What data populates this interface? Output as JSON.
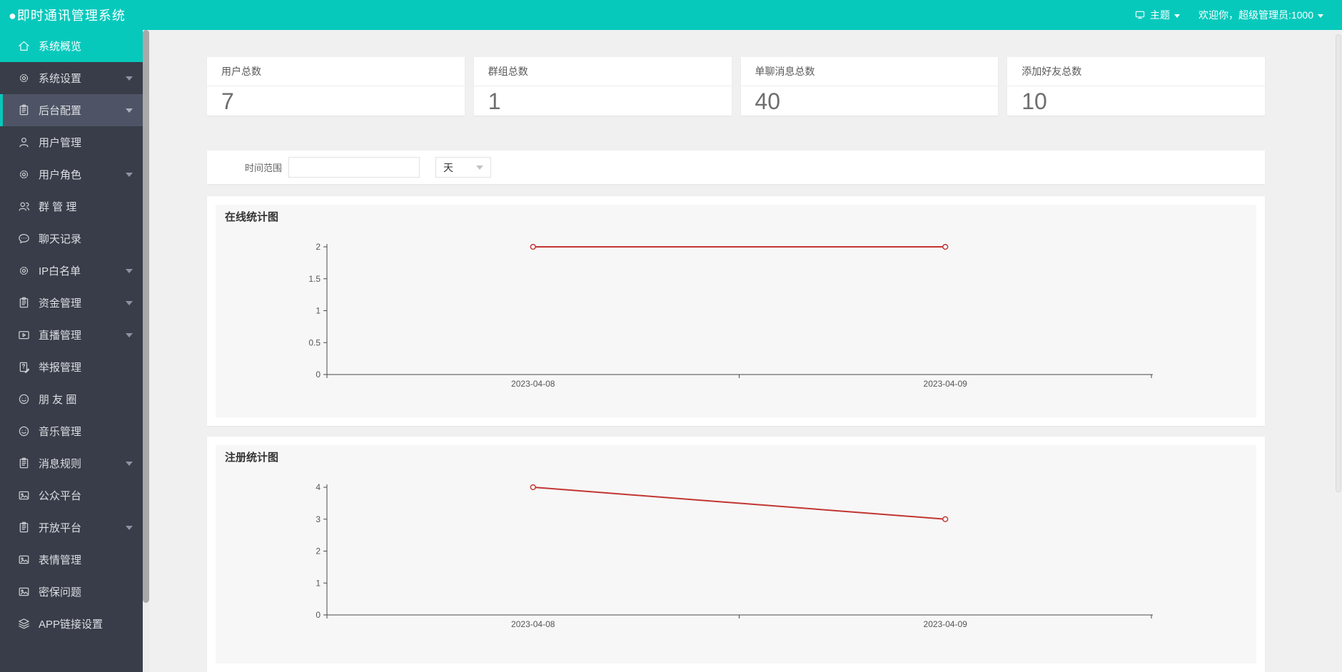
{
  "header": {
    "title": "●即时通讯管理系统",
    "theme_label": "主题",
    "welcome": "欢迎你，超级管理员:1000"
  },
  "sidebar": {
    "items": [
      {
        "label": "系统概览",
        "icon": "home-icon",
        "active": true,
        "highlight": false,
        "arrow": false
      },
      {
        "label": "系统设置",
        "icon": "gear-icon",
        "active": false,
        "highlight": false,
        "arrow": true
      },
      {
        "label": "后台配置",
        "icon": "clipboard-icon",
        "active": false,
        "highlight": true,
        "arrow": true
      },
      {
        "label": "用户管理",
        "icon": "user-icon",
        "active": false,
        "highlight": false,
        "arrow": false
      },
      {
        "label": "用户角色",
        "icon": "gear-icon",
        "active": false,
        "highlight": false,
        "arrow": true
      },
      {
        "label": "群 管 理",
        "icon": "users-icon",
        "active": false,
        "highlight": false,
        "arrow": false
      },
      {
        "label": "聊天记录",
        "icon": "chat-icon",
        "active": false,
        "highlight": false,
        "arrow": false
      },
      {
        "label": "IP白名单",
        "icon": "gear-icon",
        "active": false,
        "highlight": false,
        "arrow": true
      },
      {
        "label": "资金管理",
        "icon": "clipboard-icon",
        "active": false,
        "highlight": false,
        "arrow": true
      },
      {
        "label": "直播管理",
        "icon": "video-icon",
        "active": false,
        "highlight": false,
        "arrow": true
      },
      {
        "label": "举报管理",
        "icon": "report-icon",
        "active": false,
        "highlight": false,
        "arrow": false
      },
      {
        "label": "朋 友 圈",
        "icon": "smiley-icon",
        "active": false,
        "highlight": false,
        "arrow": false
      },
      {
        "label": "音乐管理",
        "icon": "smiley-icon",
        "active": false,
        "highlight": false,
        "arrow": false
      },
      {
        "label": "消息规则",
        "icon": "clipboard-icon",
        "active": false,
        "highlight": false,
        "arrow": true
      },
      {
        "label": "公众平台",
        "icon": "image-icon",
        "active": false,
        "highlight": false,
        "arrow": false
      },
      {
        "label": "开放平台",
        "icon": "clipboard-icon",
        "active": false,
        "highlight": false,
        "arrow": true
      },
      {
        "label": "表情管理",
        "icon": "image-icon",
        "active": false,
        "highlight": false,
        "arrow": false
      },
      {
        "label": "密保问题",
        "icon": "image-icon",
        "active": false,
        "highlight": false,
        "arrow": false
      },
      {
        "label": "APP链接设置",
        "icon": "layers-icon",
        "active": false,
        "highlight": false,
        "arrow": false
      }
    ]
  },
  "stats": {
    "cards": [
      {
        "label": "用户总数",
        "value": "7"
      },
      {
        "label": "群组总数",
        "value": "1"
      },
      {
        "label": "单聊消息总数",
        "value": "40"
      },
      {
        "label": "添加好友总数",
        "value": "10"
      }
    ]
  },
  "filter": {
    "label": "时间范围",
    "input_value": "",
    "unit_value": "天"
  },
  "colors": {
    "accent": "#06c9bc",
    "sidebar_bg": "#393d49",
    "page_bg": "#f0f0f0",
    "chart_line": "#c23531"
  },
  "chart_data": [
    {
      "type": "line",
      "title": "在线统计图",
      "x": [
        "2023-04-08",
        "2023-04-09"
      ],
      "values": [
        2,
        2
      ],
      "yticks": [
        0,
        0.5,
        1,
        1.5,
        2
      ],
      "ylim": [
        0,
        2
      ],
      "grid": false,
      "marker": "open-circle"
    },
    {
      "type": "line",
      "title": "注册统计图",
      "x": [
        "2023-04-08",
        "2023-04-09"
      ],
      "values": [
        4,
        3
      ],
      "yticks": [
        0,
        1,
        2,
        3,
        4
      ],
      "ylim": [
        0,
        4
      ],
      "grid": false,
      "marker": "open-circle"
    }
  ]
}
